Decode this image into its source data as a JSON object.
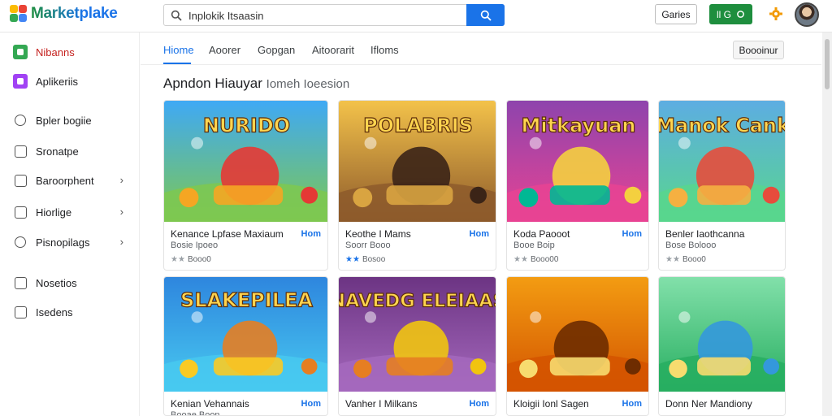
{
  "app": {
    "logo_text": "Marketplake",
    "brand_colors": [
      "#34a853",
      "#ea4335",
      "#fbbc04",
      "#4285f4"
    ]
  },
  "search": {
    "value": "Inplokik Itsaasin",
    "placeholder": "Inplokik Itsaasin",
    "button_icon": "search-icon"
  },
  "header": {
    "outline_button": "Garies",
    "green_button": "ll G",
    "settings_icon": "gear-icon",
    "accent": "#1a73e8",
    "green": "#1e8e3e"
  },
  "sidebar": {
    "items": [
      {
        "label": "Nibanns",
        "icon": "apps-icon",
        "color": "#34a853",
        "chevron": false
      },
      {
        "label": "Aplikeriis",
        "icon": "app-store-icon",
        "color": "#a142f4",
        "chevron": false
      },
      {
        "label": "Bpler bogiie",
        "icon": "compass-icon",
        "chevron": false
      },
      {
        "label": "Sronatpe",
        "icon": "bookmark-icon",
        "chevron": false
      },
      {
        "label": "Baroorphent",
        "icon": "window-icon",
        "chevron": true
      },
      {
        "label": "Hiorlige",
        "icon": "document-icon",
        "chevron": true
      },
      {
        "label": "Pisnopilags",
        "icon": "search-icon",
        "chevron": true
      },
      {
        "label": "Nosetios",
        "icon": "check-icon",
        "chevron": false
      },
      {
        "label": "Isedens",
        "icon": "image-icon",
        "chevron": false
      }
    ]
  },
  "tabs": [
    {
      "label": "Hiome",
      "active": true
    },
    {
      "label": "Aoorer",
      "active": false
    },
    {
      "label": "Gopgan",
      "active": false
    },
    {
      "label": "Aitoorarit",
      "active": false
    },
    {
      "label": "Ifloms",
      "active": false
    }
  ],
  "filter_button": "Boooinur",
  "section": {
    "title": "Apndon Hiauyar",
    "subtitle": "Iomeh Ioeesion"
  },
  "cards": [
    {
      "title": "Kenance Lpfase Maxiaum",
      "price": "Hom",
      "sub": "Bosie Ipoeo",
      "rating": "Booo0",
      "stars": [
        "grey",
        "grey"
      ],
      "art": "car",
      "art_text": "NURIDO"
    },
    {
      "title": "Keothe I Mams",
      "price": "Hom",
      "sub": "Soorr Booo",
      "rating": "Bosoo",
      "stars": [
        "blue",
        "blue"
      ],
      "art": "pirate",
      "art_text": "POLABRIS"
    },
    {
      "title": "Koda Paooot",
      "price": "Hom",
      "sub": "Booe Boip",
      "rating": "Booo00",
      "stars": [
        "grey",
        "grey"
      ],
      "art": "arcade",
      "art_text": "Mitkayuan"
    },
    {
      "title": "Benler Iaothcanna",
      "price": "",
      "sub": "Bose Bolooo",
      "rating": "Booo0",
      "stars": [
        "grey",
        "grey"
      ],
      "art": "kids",
      "art_text": "Manok Cank"
    },
    {
      "title": "Kenian Vehannais",
      "price": "Hom",
      "sub": "Booae Boon",
      "rating": "",
      "stars": [],
      "art": "dog",
      "art_text": "SLAKEPILEA"
    },
    {
      "title": "Vanher I Milkans",
      "price": "Hom",
      "sub": "",
      "rating": "",
      "stars": [],
      "art": "gnomes",
      "art_text": "NAVEDG ELEIAAS"
    },
    {
      "title": "Kloigii Ionl Sagen",
      "price": "Hom",
      "sub": "",
      "rating": "",
      "stars": [],
      "art": "canyon",
      "art_text": ""
    },
    {
      "title": "Donn Ner Mandiony",
      "price": "",
      "sub": "",
      "rating": "",
      "stars": [],
      "art": "garden",
      "art_text": ""
    }
  ]
}
